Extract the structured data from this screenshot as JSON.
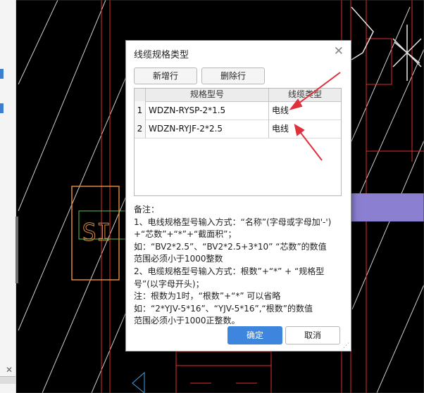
{
  "cad": {
    "label": "SI"
  },
  "dialog": {
    "title": "线缆规格类型",
    "add_row_label": "新增行",
    "delete_row_label": "删除行",
    "columns": [
      "规格型号",
      "线缆类型"
    ],
    "rows": [
      {
        "index": "1",
        "spec": "WDZN-RYSP-2*1.5",
        "type": "电线"
      },
      {
        "index": "2",
        "spec": "WDZN-RYJF-2*2.5",
        "type": "电线"
      }
    ],
    "notes": [
      "备注：",
      "1、电线规格型号输入方式：“名称”(字母或字母加'-')",
      "+“芯数”+“*”+“截面积”；",
      "如：“BV2*2.5”、“BV2*2.5+3*10” “芯数”的数值",
      "范围必须小于1000整数",
      "2、电缆规格型号输入方式：根数”+“*” + “规格型",
      "号”(以字母开头)；",
      "注：根数为1时，“根数”+“*” 可以省略",
      "如：“2*YJV-5*16”、“YJV-5*16”,“根数”的数值",
      "范围必须小于1000正整数。"
    ],
    "ok_label": "确定",
    "cancel_label": "取消"
  },
  "colors": {
    "accent": "#3e86dd",
    "annotation": "#e0303c",
    "highlight": "#8a7fd0"
  }
}
